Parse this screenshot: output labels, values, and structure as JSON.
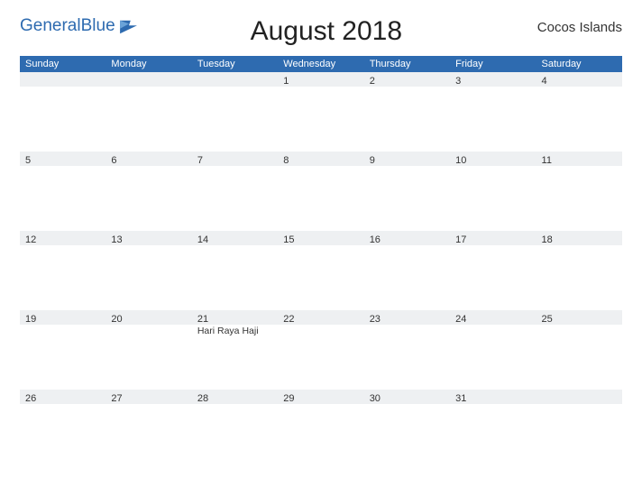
{
  "brand": {
    "general": "General",
    "blue": "Blue"
  },
  "title": "August 2018",
  "region": "Cocos Islands",
  "dow": [
    "Sunday",
    "Monday",
    "Tuesday",
    "Wednesday",
    "Thursday",
    "Friday",
    "Saturday"
  ],
  "weeks": [
    [
      {
        "n": ""
      },
      {
        "n": ""
      },
      {
        "n": ""
      },
      {
        "n": "1"
      },
      {
        "n": "2"
      },
      {
        "n": "3"
      },
      {
        "n": "4"
      }
    ],
    [
      {
        "n": "5"
      },
      {
        "n": "6"
      },
      {
        "n": "7"
      },
      {
        "n": "8"
      },
      {
        "n": "9"
      },
      {
        "n": "10"
      },
      {
        "n": "11"
      }
    ],
    [
      {
        "n": "12"
      },
      {
        "n": "13"
      },
      {
        "n": "14"
      },
      {
        "n": "15"
      },
      {
        "n": "16"
      },
      {
        "n": "17"
      },
      {
        "n": "18"
      }
    ],
    [
      {
        "n": "19"
      },
      {
        "n": "20"
      },
      {
        "n": "21",
        "event": "Hari Raya Haji"
      },
      {
        "n": "22"
      },
      {
        "n": "23"
      },
      {
        "n": "24"
      },
      {
        "n": "25"
      }
    ],
    [
      {
        "n": "26"
      },
      {
        "n": "27"
      },
      {
        "n": "28"
      },
      {
        "n": "29"
      },
      {
        "n": "30"
      },
      {
        "n": "31"
      },
      {
        "n": ""
      }
    ]
  ]
}
